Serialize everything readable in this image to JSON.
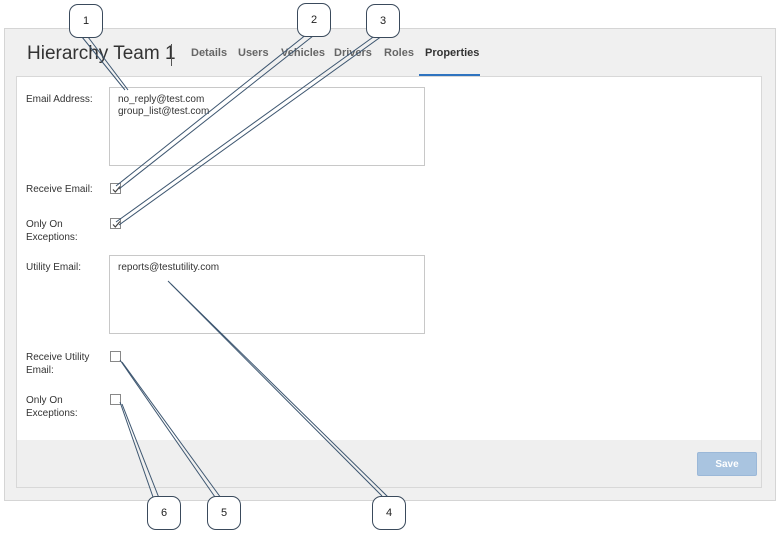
{
  "header": {
    "title": "Hierarchy Team 1",
    "tabs": [
      {
        "label": "Details"
      },
      {
        "label": "Users"
      },
      {
        "label": "Vehicles"
      },
      {
        "label": "Drivers"
      },
      {
        "label": "Roles"
      },
      {
        "label": "Properties",
        "active": true
      }
    ]
  },
  "form": {
    "email_address_label": "Email Address:",
    "email_address_lines": [
      "no_reply@test.com",
      "group_list@test.com"
    ],
    "receive_email_label": "Receive Email:",
    "receive_email_checked": true,
    "only_on_exceptions_label_1": "Only On",
    "only_on_exceptions_label_2": "Exceptions:",
    "only_on_exceptions_checked": true,
    "utility_email_label": "Utility Email:",
    "utility_email_value": "reports@testutility.com",
    "receive_utility_label_1": "Receive Utility",
    "receive_utility_label_2": "Email:",
    "receive_utility_checked": false,
    "utility_exceptions_label_1": "Only On",
    "utility_exceptions_label_2": "Exceptions:",
    "utility_exceptions_checked": false
  },
  "footer": {
    "save_label": "Save"
  },
  "callouts": [
    "1",
    "2",
    "3",
    "4",
    "5",
    "6"
  ],
  "colors": {
    "accent": "#2f74c0",
    "save_button_disabled": "#a9c4e0"
  }
}
